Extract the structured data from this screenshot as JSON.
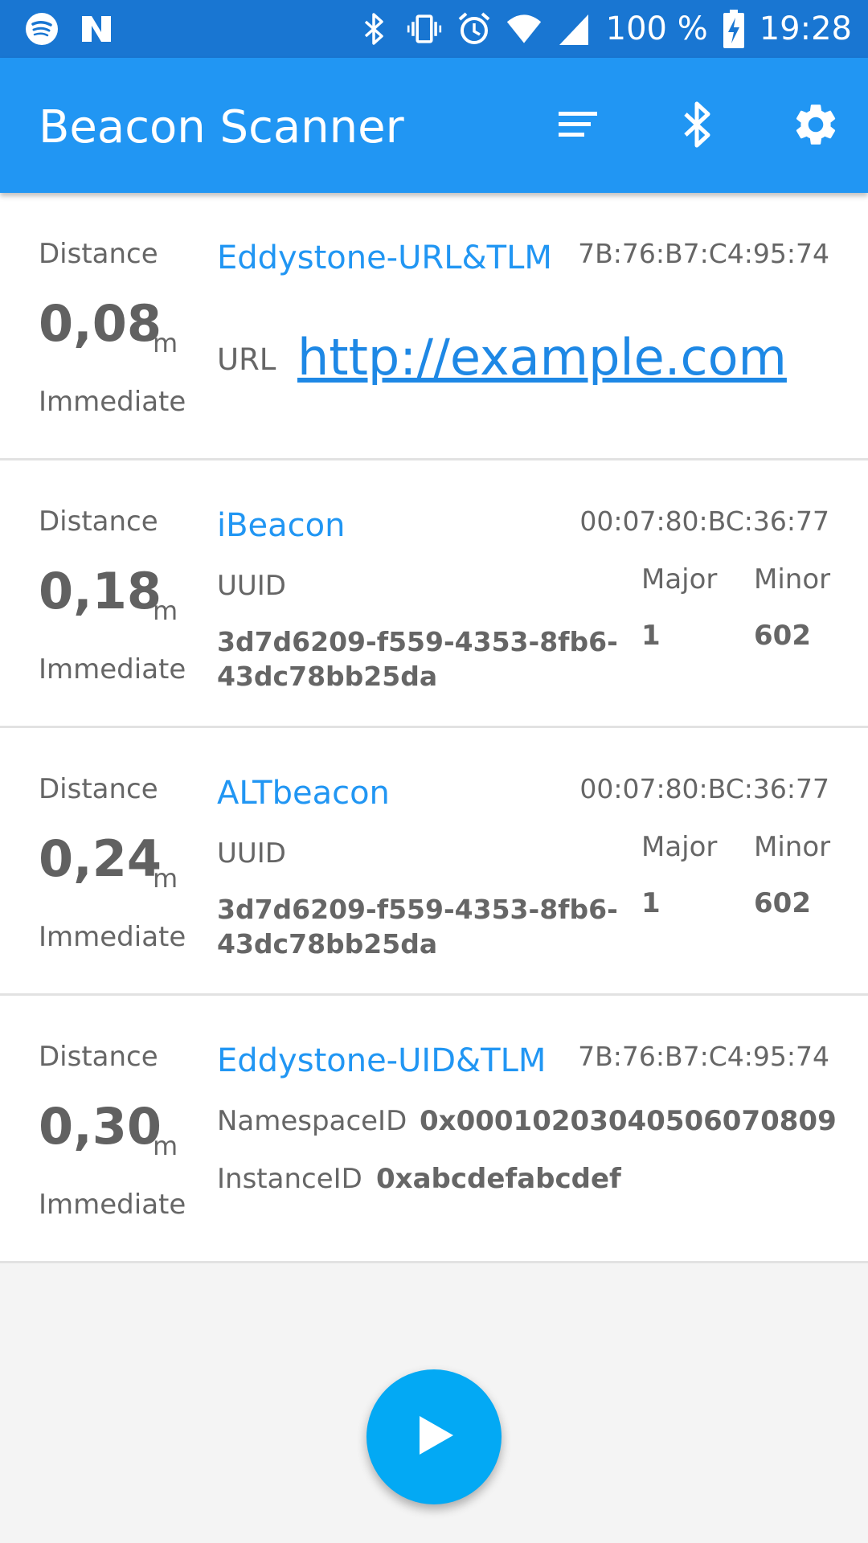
{
  "statusbar": {
    "battery": "100 %",
    "time": "19:28",
    "left_icons": [
      "spotify-icon",
      "n-notification-icon"
    ],
    "right_icons": [
      "bluetooth-icon",
      "vibrate-icon",
      "alarm-icon",
      "wifi-icon",
      "signal-icon",
      "battery-charging-icon"
    ]
  },
  "appbar": {
    "title": "Beacon Scanner",
    "actions": [
      "sort-icon",
      "bluetooth-icon",
      "settings-icon"
    ],
    "color": "#2196f3"
  },
  "beacons": [
    {
      "distance_label": "Distance",
      "distance": "0,08",
      "unit": "m",
      "proximity": "Immediate",
      "type": "Eddystone-URL&TLM",
      "mac": "7B:76:B7:C4:95:74",
      "url_label": "URL",
      "url": "http://example.com"
    },
    {
      "distance_label": "Distance",
      "distance": "0,18",
      "unit": "m",
      "proximity": "Immediate",
      "type": "iBeacon",
      "mac": "00:07:80:BC:36:77",
      "uuid_label": "UUID",
      "uuid": "3d7d6209-f559-4353-8fb6-43dc78bb25da",
      "major_label": "Major",
      "minor_label": "Minor",
      "major": "1",
      "minor": "602"
    },
    {
      "distance_label": "Distance",
      "distance": "0,24",
      "unit": "m",
      "proximity": "Immediate",
      "type": "ALTbeacon",
      "mac": "00:07:80:BC:36:77",
      "uuid_label": "UUID",
      "uuid": "3d7d6209-f559-4353-8fb6-43dc78bb25da",
      "major_label": "Major",
      "minor_label": "Minor",
      "major": "1",
      "minor": "602"
    },
    {
      "distance_label": "Distance",
      "distance": "0,30",
      "unit": "m",
      "proximity": "Immediate",
      "type": "Eddystone-UID&TLM",
      "mac": "7B:76:B7:C4:95:74",
      "namespace_label": "NamespaceID",
      "namespace": "0x00010203040506070809",
      "instance_label": "InstanceID",
      "instance": "0xabcdefabcdef"
    }
  ],
  "fab": {
    "icon": "play-icon",
    "color": "#03a9f4"
  }
}
